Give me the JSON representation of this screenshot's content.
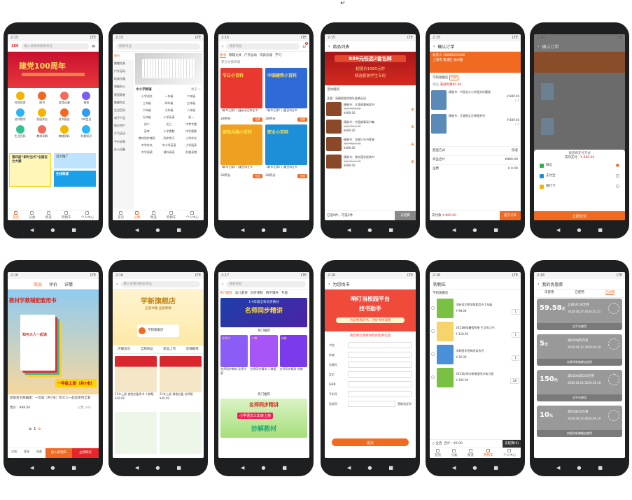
{
  "status": {
    "time1": "2:15",
    "time2": "2:16",
    "time3": "2:17",
    "time4": "2:14",
    "sig": "LTE"
  },
  "corner_mark": "↵",
  "tabbar": [
    "首页",
    "分类",
    "频道",
    "购物车",
    "个人中心"
  ],
  "s1": {
    "search": "输入关键词搜索商品",
    "banner": "建党100周年",
    "logo": "100",
    "icons": [
      "时尚体育",
      "图书",
      "游戏动漫",
      "课程",
      "名师助学",
      "家庭作业",
      "读书报告",
      "VIP会员",
      "生活百科",
      "教材详解",
      "教辅资料",
      "科普知识"
    ],
    "promo1": "第四届“新时当代”全国征文大赛",
    "promo2": "首页推广",
    "promo3": "在线商城"
  },
  "s2": {
    "search": "搜索商品",
    "cats": [
      "图书",
      "教辅文具",
      "户外运动",
      "玩具乐器",
      "电脑办公",
      "家居家装",
      "教辅专区",
      "生活百科",
      "电子产品",
      "地方特产",
      "乒乓运动",
      "平价好物",
      "办公设备"
    ],
    "sub_title": "中小学教辅",
    "more": "更多 >",
    "grid": [
      "小学语文",
      "一年级",
      "二年级",
      "三年级",
      "四年级",
      "五年级",
      "六年级",
      "七年级",
      "八年级",
      "九年级",
      "小学英语",
      "初一",
      "初二",
      "初三",
      "中考专题",
      "高考",
      "小学奥数",
      "中学奥数",
      "教材同步辅导",
      "同步练习",
      "小学作文",
      "中学作文",
      "中小学英语",
      "小学阅读",
      "中学阅读",
      "课外阅读",
      "科普读物"
    ]
  },
  "s3": {
    "search": "搜索商品",
    "tabs": [
      "图书",
      "教辅文具",
      "户外运动",
      "玩具乐器",
      "学习"
    ],
    "filter": "积分兑换商城",
    "badge": "2",
    "books": [
      {
        "title": "节日小百科",
        "desc": "【新华正版】儿童必读百科全书",
        "price": "28积分",
        "btn": "兑换"
      },
      {
        "title": "中国建筑小百科",
        "desc": "【新华正版】儿童百科全书",
        "price": "28积分",
        "btn": "兑换"
      },
      {
        "title": "建筑兵器小百科",
        "desc": "【新华正版】儿童百科全书",
        "price": "28积分",
        "btn": "兑换"
      },
      {
        "title": "职业小百科",
        "desc": "【新华正版】儿童百科全书",
        "price": "28积分",
        "btn": "兑换"
      }
    ]
  },
  "s4": {
    "title": "商品列表",
    "banner": "889元任选2套包邮",
    "banner2": "超值价1080元的",
    "banner3": "精选套装学生专用",
    "rule_label": "活动规则",
    "notice": "注意：请确保收货地址准确无误",
    "items": [
      {
        "name": "精装书：正版故事阅读书",
        "price": "¥480.00",
        "old": "原价¥550.00"
      },
      {
        "name": "精装书：中国故事读书集",
        "price": "¥480.00",
        "old": "原价¥550.00"
      },
      {
        "name": "精装书：金融少年书套装",
        "price": "¥480.00",
        "old": "原价¥550.00"
      },
      {
        "name": "精装书：课文国学经典书",
        "price": "¥480.00",
        "old": "原价¥550.00"
      }
    ],
    "footer": "已选0件，可选2件",
    "footer_btn": "去结算"
  },
  "s5": {
    "title": "确认订单",
    "addr_name": "收货人 18600559426",
    "addr": "上海市 黄浦区 福州路",
    "store": "学新旗舰店",
    "store_tag": "包邮",
    "gift": "赠品",
    "gift_note": "满减优惠¥0.00",
    "items": [
      {
        "name": "精装书：中国北大小学图文珍藏版",
        "price": "¥ 889.00",
        "qty": "x 1"
      },
      {
        "name": "精装书：正版图文注释版系列",
        "price": "¥ 889.00",
        "qty": "x 1"
      }
    ],
    "rows": [
      {
        "k": "配送方式",
        "v": "快递"
      },
      {
        "k": "商品合计",
        "v": "¥889.00"
      },
      {
        "k": "运费",
        "v": "¥ 0.00"
      }
    ],
    "pay_label": "实付款",
    "pay": "¥ 889.00",
    "submit": "提交订单"
  },
  "s6": {
    "title": "确认订单",
    "popup_title": "请选择支付方式",
    "amount_label": "实际支付：",
    "amount": "¥ 689.00",
    "methods": [
      "微信",
      "支付宝",
      "银行卡"
    ],
    "confirm": "立即支付"
  },
  "s7": {
    "tabs": [
      "商品",
      "评价",
      "详情"
    ],
    "banner_title": "教材学教辅配套用书",
    "book_title": "知与大人一起读",
    "bundle": "一年级上册（共7本）",
    "name": "新版语文部编版：一年级（共7本）和大人一起读系列全套",
    "price": "售价：¥98.00",
    "sales": "已售 343",
    "qty": "1",
    "buttons": [
      "加入购物车",
      "立即购买"
    ],
    "icons": [
      "店铺",
      "客服",
      "收藏"
    ]
  },
  "s8": {
    "search": "输入关键词搜索商品",
    "banner": "学新旗舰店",
    "banner_sub": "正版书籍 品质保障",
    "store_name": "学新旗舰店",
    "tabs": [
      "店铺首页",
      "全部商品",
      "新品上市",
      "店铺推荐"
    ],
    "items": [
      {
        "name": "21年上册 课堂必备用书 人教版",
        "price": "¥39.90"
      },
      {
        "name": "21年上册 课堂必备 北师版",
        "price": "¥39.90"
      }
    ]
  },
  "s9": {
    "search": "搜索商品",
    "tabs": [
      "热门推荐",
      "幼儿教育",
      "同步课程",
      "教学辅导",
      "专题"
    ],
    "banner": "名师同步精讲",
    "banner_top": "1-9年级全科同步教材",
    "section1": "热门推荐",
    "section2": "热门推荐",
    "items": [
      {
        "name": "名师同步教材 北师大版",
        "tag": "北师大"
      },
      {
        "name": "名师同步精讲 人教版",
        "tag": "人教"
      },
      {
        "name": "名师同步精讲 苏教",
        "tag": "苏教"
      }
    ],
    "promo": "名师同步精讲",
    "promo2": "小学语文三年级上册",
    "promo3": "妙解教材"
  },
  "s10": {
    "title": "为您找书",
    "banner": "响叮当校园平台",
    "banner2": "找书助手",
    "banner3": "为读者找好书，为好书找读者",
    "form_title": "请您填写想要寻找的图书信息",
    "fields": [
      "书名",
      "作者",
      "出版社",
      "定价",
      "ISBN",
      "手机号",
      "验证码"
    ],
    "captcha": "获取验证码",
    "submit": "提交"
  },
  "s11": {
    "title": "购物车",
    "store": "学新旗舰店",
    "items": [
      {
        "name": "学新语文教学配套用书 1年级",
        "price": "¥ 98.00",
        "qty": "1"
      },
      {
        "name": "2021新版暑假衔接 生字练习书",
        "price": "¥ 118.00",
        "qty": "1"
      },
      {
        "name": "学新国学经典阅读系列",
        "price": "¥ 56.00",
        "qty": "1"
      },
      {
        "name": "2021秋季学期课堂同步练习册",
        "price": "¥ 106.00",
        "qty": "28"
      }
    ],
    "select_all": "全选",
    "total": "合计：¥0.00",
    "checkout": "去结算(0)"
  },
  "s12": {
    "title": "我的优惠券",
    "tabs": [
      "未使用",
      "已使用",
      "已过期"
    ],
    "coupons": [
      {
        "amount": "59.58",
        "unit": "元",
        "cond": "立减59.58元券",
        "date": "2020.04.27-2020.05.31",
        "scope": "全平台使用"
      },
      {
        "amount": "5",
        "unit": "元",
        "cond": "满100减5元券",
        "date": "2020.04.22-2020.06.10",
        "scope": "仅限学新旗舰店使用"
      },
      {
        "amount": "150",
        "unit": "元",
        "cond": "满1000减150元券",
        "date": "2020.04.22-2020.06.10",
        "scope": "全平台使用"
      },
      {
        "amount": "10",
        "unit": "元",
        "cond": "满50减10元券",
        "date": "2020.04.22-2020.06.10",
        "scope": "仅限学新旗舰店使用"
      }
    ]
  }
}
